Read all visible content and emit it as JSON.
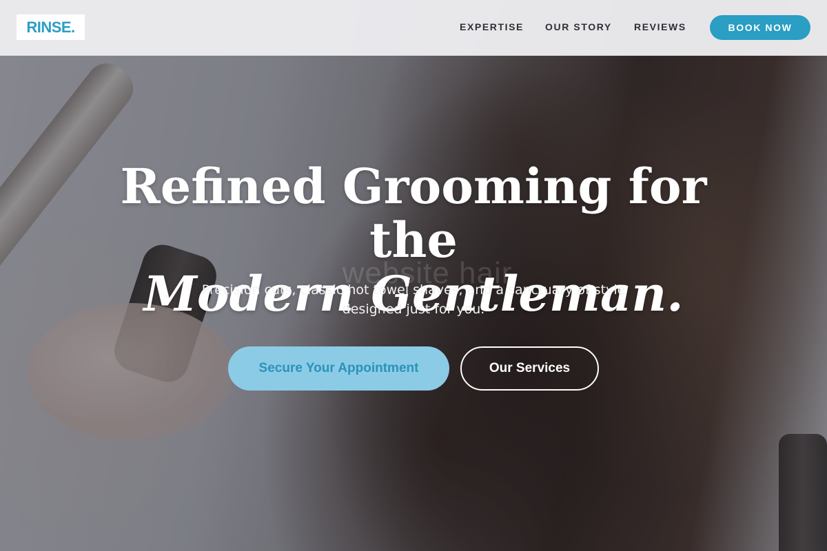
{
  "header": {
    "logo": "RINSE.",
    "nav": {
      "expertise": "EXPERTISE",
      "story": "OUR STORY",
      "reviews": "REVIEWS"
    },
    "cta": "BOOK NOW"
  },
  "hero": {
    "headline_line1": "Refined Grooming for the",
    "headline_line2": "Modern Gentleman.",
    "subtext": "Precision cuts, classic hot towel shaves, and a sanctuary of style designed just for you.",
    "watermark": "website hair",
    "primary_button": "Secure Your Appointment",
    "secondary_button": "Our Services"
  },
  "colors": {
    "brand": "#2a9ec3",
    "primary_button_bg": "#8ccbe6",
    "header_bg": "#ececef",
    "nav_text": "#2c2f36"
  }
}
